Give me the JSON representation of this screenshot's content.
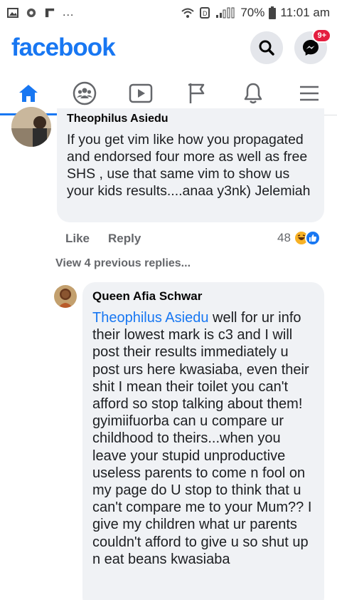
{
  "status_bar": {
    "overflow": "...",
    "battery": "70%",
    "time": "11:01 am"
  },
  "header": {
    "logo": "facebook",
    "messenger_badge": "9+"
  },
  "nav": {
    "items": [
      "home-icon",
      "groups-icon",
      "watch-icon",
      "pages-flag-icon",
      "notifications-bell-icon",
      "menu-icon"
    ],
    "active": "home-icon",
    "accent": "#1877f2"
  },
  "comment1": {
    "author": "Theophilus Asiedu",
    "text": "If you get vim like how you propagated and endorsed four more as well as free SHS , use that same vim to show us your kids results....anaa y3nk) Jelemiah",
    "like_label": "Like",
    "reply_label": "Reply",
    "reaction_count": "48"
  },
  "view_previous": "View 4 previous replies...",
  "comment2": {
    "author": "Queen Afia Schwar",
    "mention": "Theophilus Asiedu",
    "text": " well for ur info their lowest mark is c3 and I will post their results immediately u post urs here kwasiaba, even their shit I mean their toilet you can't afford so stop talking about them! gyimiifuorba can u compare ur childhood to theirs...when you leave your stupid unproductive useless parents to come n fool on my page do U stop to think that u can't compare me to your Mum?? I give my children what ur parents couldn't afford to give u so shut up n eat beans kwasiaba"
  }
}
